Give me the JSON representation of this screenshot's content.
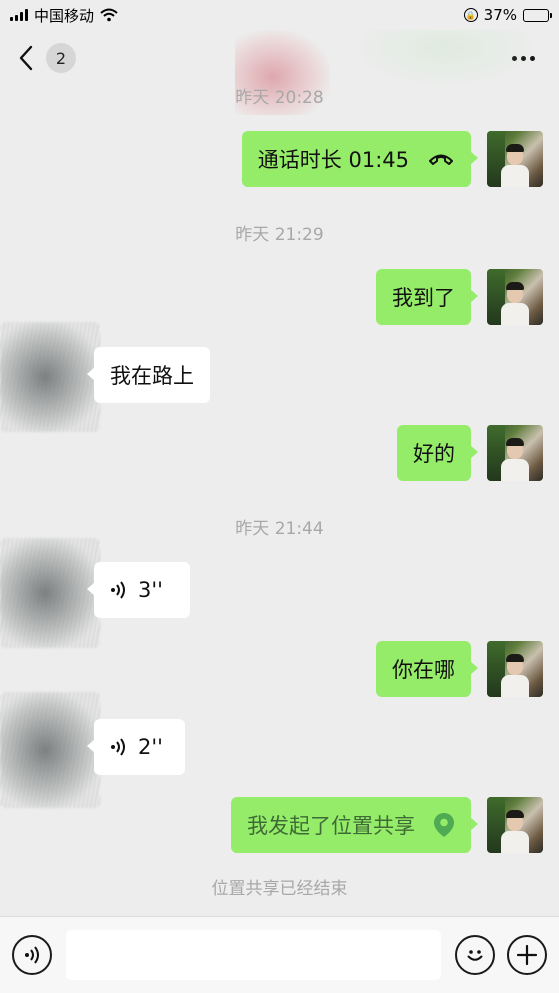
{
  "status_bar": {
    "carrier": "中国移动",
    "battery_percent": "37%",
    "battery_level": 0.37
  },
  "nav": {
    "unread_count": "2"
  },
  "messages": [
    {
      "kind": "time",
      "text": "昨天 20:28"
    },
    {
      "kind": "me",
      "type": "call",
      "text": "通话时长 01:45",
      "icon": "phone-hangup-icon"
    },
    {
      "kind": "time",
      "text": "昨天 21:29"
    },
    {
      "kind": "me",
      "type": "text",
      "text": "我到了"
    },
    {
      "kind": "them",
      "type": "text",
      "text": "我在路上"
    },
    {
      "kind": "me",
      "type": "text",
      "text": "好的"
    },
    {
      "kind": "time",
      "text": "昨天 21:44"
    },
    {
      "kind": "them",
      "type": "voice",
      "text": "3''",
      "icon": "voice-wave-icon"
    },
    {
      "kind": "me",
      "type": "text",
      "text": "你在哪"
    },
    {
      "kind": "them",
      "type": "voice",
      "text": "2''",
      "icon": "voice-wave-icon"
    },
    {
      "kind": "me",
      "type": "location",
      "text": "我发起了位置共享",
      "icon": "location-pin-icon"
    },
    {
      "kind": "system",
      "text": "位置共享已经结束"
    }
  ],
  "input_bar": {
    "value": "",
    "placeholder": "",
    "icons": [
      "voice-input-icon",
      "emoji-icon",
      "add-icon"
    ]
  },
  "colors": {
    "background": "#ededed",
    "my_bubble": "#95ec69",
    "their_bubble": "#ffffff",
    "timestamp": "#a8a8a8",
    "location_pin": "#4eaa53"
  }
}
